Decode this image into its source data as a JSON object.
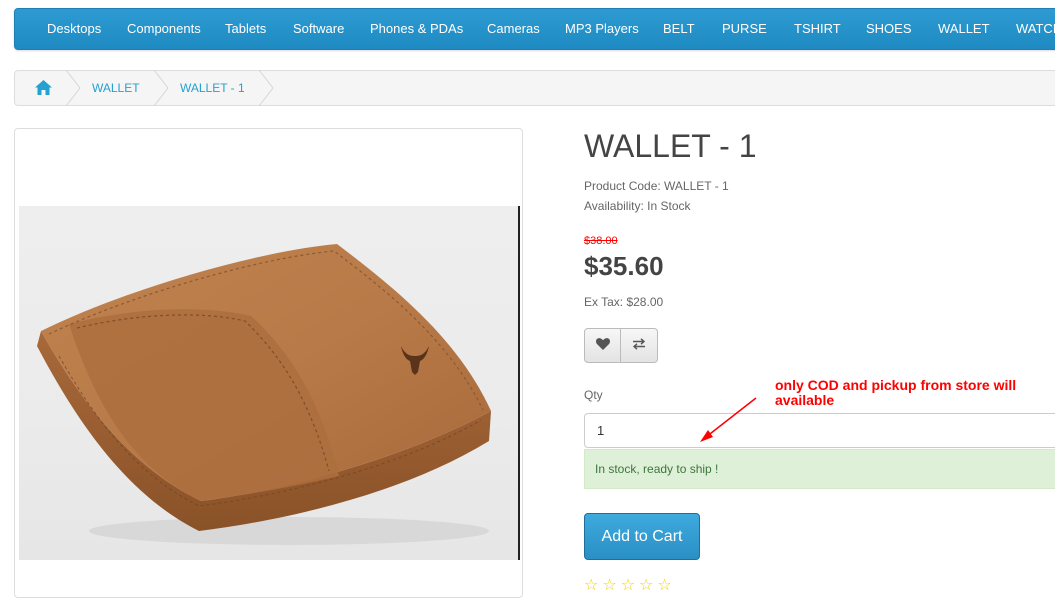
{
  "menu": {
    "items": [
      "Desktops",
      "Components",
      "Tablets",
      "Software",
      "Phones & PDAs",
      "Cameras",
      "MP3 Players",
      "BELT",
      "PURSE",
      "TSHIRT",
      "SHOES",
      "WALLET",
      "WATCH"
    ]
  },
  "breadcrumb": {
    "home_icon": "home-icon",
    "items": [
      "WALLET",
      "WALLET - 1"
    ]
  },
  "product": {
    "title": "WALLET - 1",
    "code_label": "Product Code: WALLET - 1",
    "availability_label": "Availability: In Stock",
    "old_price": "$38.00",
    "price": "$35.60",
    "ex_tax": "Ex Tax: $28.00",
    "wishlist_icon": "heart-icon",
    "compare_icon": "compare-arrows-icon",
    "qty_label": "Qty",
    "qty_value": "1",
    "stock_message": "In stock, ready to ship !",
    "add_to_cart": "Add to Cart"
  },
  "annotation": {
    "note": "only COD and pickup from store will available"
  },
  "colors": {
    "menu_bg": "#2196d0",
    "link": "#23a1d1",
    "old_price": "#ff0000",
    "note": "#ff0000",
    "stock_bg": "#dff0d8",
    "button": "#2a8fc4"
  }
}
